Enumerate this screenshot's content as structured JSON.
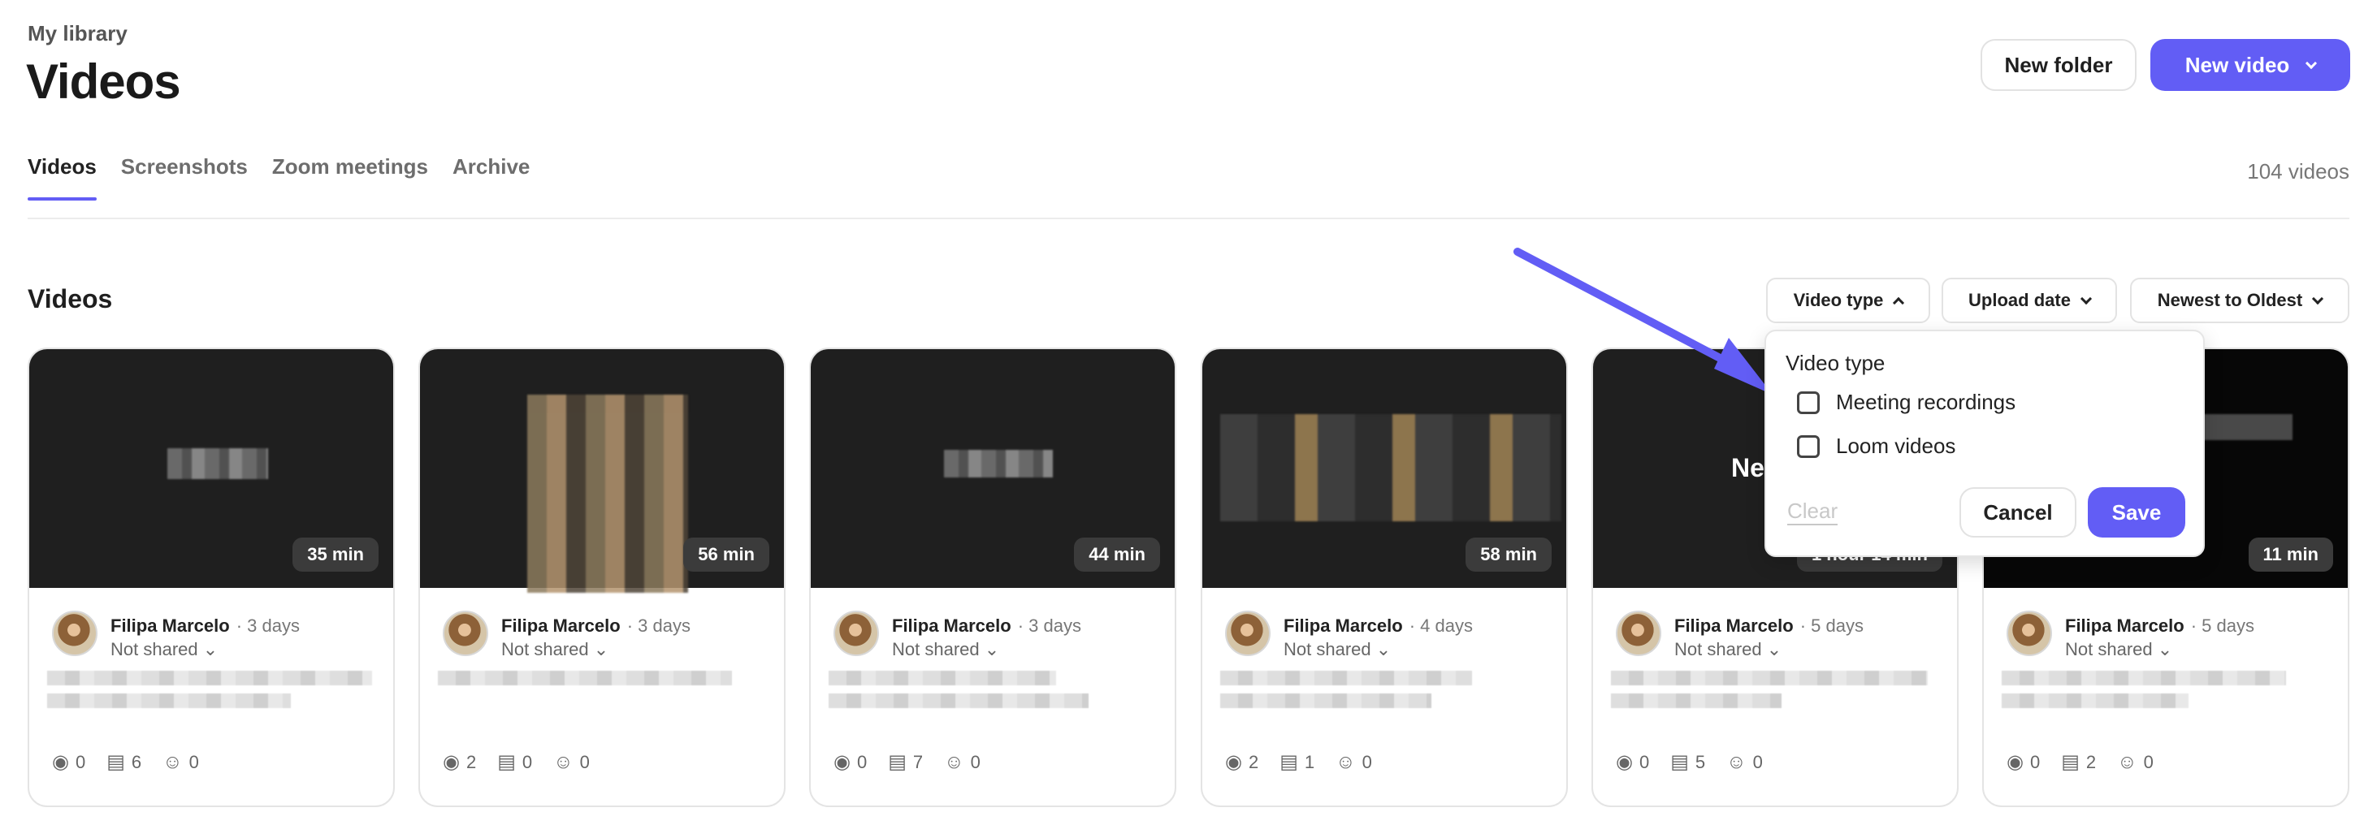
{
  "header": {
    "breadcrumb": "My library",
    "title": "Videos",
    "new_folder": "New folder",
    "new_video": "New video"
  },
  "tabs": [
    {
      "label": "Videos"
    },
    {
      "label": "Screenshots"
    },
    {
      "label": "Zoom meetings"
    },
    {
      "label": "Archive"
    }
  ],
  "video_count": "104 videos",
  "section": {
    "title": "Videos"
  },
  "filters": {
    "video_type": "Video type",
    "upload_date": "Upload date",
    "sort": "Newest to Oldest"
  },
  "dropdown": {
    "title": "Video type",
    "options": [
      "Meeting recordings",
      "Loom videos"
    ],
    "clear": "Clear",
    "cancel": "Cancel",
    "save": "Save"
  },
  "cards": [
    {
      "duration": "35 min",
      "owner": "Filipa Marcelo",
      "age": "· 3 days",
      "shared": "Not shared",
      "views": "0",
      "comments": "6",
      "reactions": "0"
    },
    {
      "duration": "56 min",
      "owner": "Filipa Marcelo",
      "age": "· 3 days",
      "shared": "Not shared",
      "views": "2",
      "comments": "0",
      "reactions": "0"
    },
    {
      "duration": "44 min",
      "owner": "Filipa Marcelo",
      "age": "· 3 days",
      "shared": "Not shared",
      "views": "0",
      "comments": "7",
      "reactions": "0"
    },
    {
      "duration": "58 min",
      "owner": "Filipa Marcelo",
      "age": "· 4 days",
      "shared": "Not shared",
      "views": "2",
      "comments": "1",
      "reactions": "0"
    },
    {
      "duration": "1 hour 14 min",
      "owner": "Filipa Marcelo",
      "age": "· 5 days",
      "shared": "Not shared",
      "views": "0",
      "comments": "5",
      "reactions": "0",
      "thumb_text": "Ne"
    },
    {
      "duration": "11 min",
      "owner": "Filipa Marcelo",
      "age": "· 5 days",
      "shared": "Not shared",
      "views": "0",
      "comments": "2",
      "reactions": "0"
    }
  ],
  "icons": {
    "views": "eye-icon",
    "comments": "comment-icon",
    "reactions": "smile-icon",
    "chevron": "chevron-down-icon"
  },
  "colors": {
    "accent": "#625df5"
  }
}
